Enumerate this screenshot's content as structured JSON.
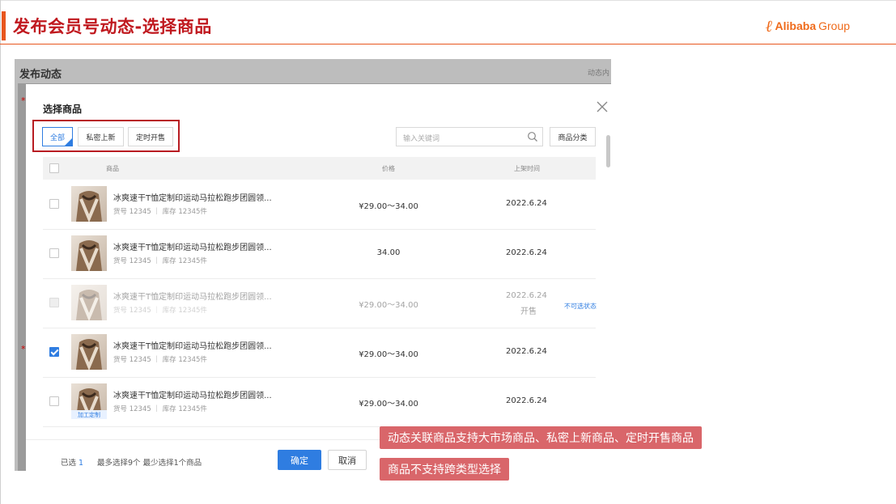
{
  "slide": {
    "title": "发布会员号动态-选择商品",
    "logo_mark": "ℓ",
    "logo_text": "Alibaba",
    "logo_group": "Group",
    "accent_color": "#e8561e"
  },
  "background_page": {
    "title": "发布动态",
    "header_right": "动态内",
    "required_mark": "*"
  },
  "modal": {
    "title": "选择商品",
    "close_icon": "close-icon",
    "tabs": [
      {
        "label": "全部",
        "active": true
      },
      {
        "label": "私密上新",
        "active": false
      },
      {
        "label": "定时开售",
        "active": false
      }
    ],
    "search": {
      "placeholder": "输入关键词",
      "icon": "search-icon"
    },
    "category_button": "商品分类",
    "columns": {
      "product": "商品",
      "price": "价格",
      "listing_time": "上架时间"
    },
    "rows": [
      {
        "name": "冰爽速干T恤定制印运动马拉松跑步团圆领...",
        "meta": "货号 12345  ｜  库存 12345件",
        "price": "¥29.00～34.00",
        "date": "2022.6.24",
        "date_sub": "",
        "state": "unchecked",
        "tag": "",
        "note": ""
      },
      {
        "name": "冰爽速干T恤定制印运动马拉松跑步团圆领...",
        "meta": "货号 12345  ｜  库存 12345件",
        "price": "34.00",
        "date": "2022.6.24",
        "date_sub": "",
        "state": "unchecked",
        "tag": "",
        "note": ""
      },
      {
        "name": "冰爽速干T恤定制印运动马拉松跑步团圆领...",
        "meta": "货号 12345  ｜  库存 12345件",
        "price": "¥29.00～34.00",
        "date": "2022.6.24",
        "date_sub": "开售",
        "state": "disabled",
        "tag": "",
        "note": "不可选状态"
      },
      {
        "name": "冰爽速干T恤定制印运动马拉松跑步团圆领...",
        "meta": "货号 12345  ｜  库存 12345件",
        "price": "¥29.00～34.00",
        "date": "2022.6.24",
        "date_sub": "",
        "state": "checked",
        "tag": "",
        "note": ""
      },
      {
        "name": "冰爽速干T恤定制印运动马拉松跑步团圆领...",
        "meta": "货号 12345  ｜  库存 12345件",
        "price": "¥29.00～34.00",
        "date": "2022.6.24",
        "date_sub": "",
        "state": "unchecked",
        "tag": "加工定制",
        "note": ""
      }
    ],
    "footer": {
      "selected_label": "已选",
      "selected_count": "1",
      "limit_text": "最多选择9个 最少选择1个商品",
      "confirm": "确定",
      "cancel": "取消"
    }
  },
  "callouts": [
    "动态关联商品支持大市场商品、私密上新商品、定时开售商品",
    "商品不支持跨类型选择"
  ],
  "colors": {
    "primary_blue": "#2f7de1",
    "title_red": "#c0191f",
    "callout_bg": "#d9666a",
    "highlight_box": "#b81c22"
  }
}
